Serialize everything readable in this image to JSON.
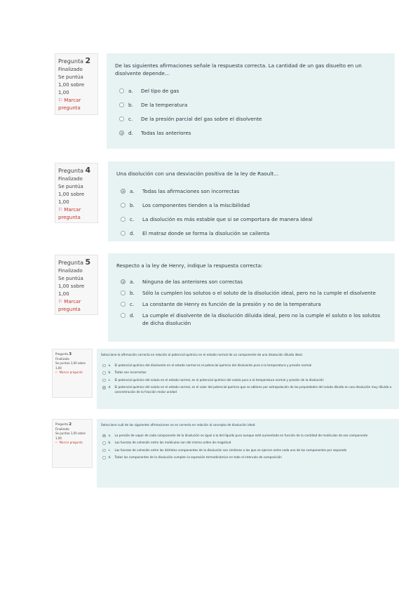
{
  "common": {
    "question_word": "Pregunta",
    "status": "Finalizado",
    "grade": "Se puntúa 1,00 sobre 1,00",
    "flag": "Marcar pregunta"
  },
  "questions": [
    {
      "number": "2",
      "text": "De las siguientes afirmaciones señale la respuesta correcta. La cantidad de un gas disuelto en un disolvente depende…",
      "options": [
        {
          "letter": "a.",
          "text": "Del tipo de gas",
          "selected": false
        },
        {
          "letter": "b.",
          "text": "De la temperatura",
          "selected": false
        },
        {
          "letter": "c.",
          "text": "De la presión parcial del gas sobre el disolvente",
          "selected": false
        },
        {
          "letter": "d.",
          "text": "Todas las anteriores",
          "selected": true
        }
      ]
    },
    {
      "number": "4",
      "text": "Una disolución con una desviación positiva de la ley de Raoult…",
      "options": [
        {
          "letter": "a.",
          "text": "Todas las afirmaciones son incorrectas",
          "selected": true
        },
        {
          "letter": "b.",
          "text": "Los componentes tienden a la miscibilidad",
          "selected": false
        },
        {
          "letter": "c.",
          "text": "La disolución es más estable que si se comportara de manera ideal",
          "selected": false
        },
        {
          "letter": "d.",
          "text": "El matraz donde se forma la disolución se calienta",
          "selected": false
        }
      ]
    },
    {
      "number": "5",
      "text": "Respecto a la ley de Henry, indique la respuesta correcta:",
      "options": [
        {
          "letter": "a.",
          "text": "Ninguna de las anteriores son correctas",
          "selected": true
        },
        {
          "letter": "b.",
          "text": "Sólo la cumplen los solutos o el soluto de la disolución ideal, pero no la cumple el disolvente",
          "selected": false
        },
        {
          "letter": "c.",
          "text": "La constante de Henry es función de la presión y no de la temperatura",
          "selected": false
        },
        {
          "letter": "d.",
          "text": "La cumple el disolvente de la disolución diluida ideal, pero no la cumple el soluto o los solutos de dicha disolución",
          "selected": false
        }
      ]
    },
    {
      "number": "3",
      "text": "Seleccione la afirmación correcta en relación al potencial químico en el estado normal de un componente de una disolución diluida ideal.",
      "options": [
        {
          "letter": "a.",
          "text": "El potencial químico del disolvente en el estado normal es el potencial químico del disolvente puro a la temperatura y presión normal",
          "selected": false
        },
        {
          "letter": "b.",
          "text": "Todas son incorrectas",
          "selected": false
        },
        {
          "letter": "c.",
          "text": "El potencial químico del soluto en el estado normal, es el potencial químico del soluto puro a la temperatura normal y presión de la disolución",
          "selected": false
        },
        {
          "letter": "d.",
          "text": "El potencial químico del soluto en el estado normal, es el valor del potencial químico que se obtiene por extrapolación de las propiedades del soluto diluido en una disolución muy diluida a concentración de la fracción molar unidad",
          "selected": true
        }
      ]
    },
    {
      "number": "2",
      "text": "Seleccione cuál de las siguientes afirmaciones no es correcta en relación al concepto de disolución ideal:",
      "options": [
        {
          "letter": "a.",
          "text": "La presión de vapor de cada componente de la disolución es igual a la del líquido puro aunque esté aumentada en función de la cantidad de moléculas de ese componente",
          "selected": true
        },
        {
          "letter": "b.",
          "text": "Las fuerzas de cohesión entre las moléculas son del mismo orden de magnitud",
          "selected": false
        },
        {
          "letter": "c.",
          "text": "Las fuerzas de cohesión entre los distintos componentes de la disolución son similares a las que se ejercen entre cada uno de los componentes por separado",
          "selected": false
        },
        {
          "letter": "d.",
          "text": "Todos los componentes de la disolución cumplen la expresión termodinámica en todo el intervalo de composición",
          "selected": false
        }
      ]
    }
  ]
}
